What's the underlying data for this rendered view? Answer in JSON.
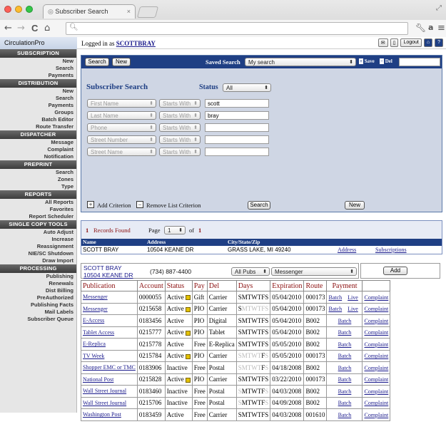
{
  "browser": {
    "tab_title": "Subscriber Search",
    "tab_close": "×",
    "url": "",
    "back": "←",
    "forward": "→",
    "reload": "C",
    "home": "⌂",
    "menu": "≡",
    "colors": {
      "red": "#fc5f57",
      "yellow": "#fdbb2d",
      "green": "#33c748"
    }
  },
  "header": {
    "brand": "CirculationPro",
    "logged_in_prefix": "Logged in as",
    "user": "SCOTTBRAY",
    "logout": "Logout"
  },
  "sidebar": [
    {
      "section": "SUBSCRIPTION",
      "items": [
        "New",
        "Search",
        "Payments"
      ]
    },
    {
      "section": "DISTRIBUTION",
      "items": [
        "New",
        "Search",
        "Payments",
        "Groups",
        "Batch Editor",
        "Route Transfer"
      ]
    },
    {
      "section": "DISPATCHER",
      "items": [
        "Message",
        "Complaint",
        "Notification"
      ]
    },
    {
      "section": "PREPRINT",
      "items": [
        "Search",
        "Zones",
        "Type"
      ]
    },
    {
      "section": "REPORTS",
      "items": [
        "All Reports",
        "Favorites",
        "Report Scheduler"
      ]
    },
    {
      "section": "SINGLE COPY TOOLS",
      "items": [
        "Auto Adjust",
        "Increase",
        "Reassignment",
        "NIE/SC Shutdown",
        "Draw Import"
      ]
    },
    {
      "section": "PROCESSING",
      "items": [
        "Publishing",
        "Renewals",
        "Dist Billing",
        "PreAuthorized",
        "Publishing Facts",
        "Mail Labels",
        "Subscriber Queue"
      ]
    }
  ],
  "search": {
    "search_btn": "Search",
    "new_btn": "New",
    "saved_search_label": "Saved Search",
    "saved_search_value": "My search",
    "save_label": "Save",
    "del_label": "Del",
    "title": "Subscriber Search",
    "status_label": "Status",
    "status_value": "All",
    "criteria": [
      {
        "field": "First Name",
        "op": "Starts With",
        "value": "scott"
      },
      {
        "field": "Last Name",
        "op": "Starts With",
        "value": "bray"
      },
      {
        "field": "Phone",
        "op": "Starts With",
        "value": ""
      },
      {
        "field": "Street Number",
        "op": "Starts With",
        "value": ""
      },
      {
        "field": "Street Name",
        "op": "Starts With",
        "value": ""
      }
    ],
    "add_criterion": "Add Criterion",
    "remove_criterion": "Remove List Criterion",
    "search_bottom": "Search",
    "new_bottom": "New"
  },
  "records": {
    "count": "1",
    "found_label": "Records Found",
    "page_label": "Page",
    "page_value": "1",
    "of_label": "of",
    "page_total": "1",
    "headers": {
      "name": "Name",
      "address": "Address",
      "csz": "City/State/Zip"
    },
    "row": {
      "name": "SCOTT BRAY",
      "address": "10504 KEANE DR",
      "csz": "GRASS LAKE, MI 49240",
      "address_link": "Address",
      "subs_link": "Subscriptions"
    }
  },
  "customer": {
    "name": "SCOTT BRAY",
    "address": "10504 KEANE DR",
    "phone": "(734) 887-4400",
    "pubs_filter": "All Pubs",
    "pub_select": "Messenger",
    "add_btn": "Add"
  },
  "subs_table": {
    "headers": [
      "Publication",
      "Account",
      "Status",
      "Pay",
      "Del",
      "Days",
      "Expiration",
      "Route",
      "Payment",
      ""
    ],
    "rows": [
      {
        "pub": "Messenger",
        "acct": "0000055",
        "status": "Active",
        "badge": true,
        "pay": "Gift",
        "del": "Carrier",
        "days_on": "SMTWTFS",
        "days_off": "",
        "exp": "05/04/2010",
        "route": "000173",
        "pay1": "Batch",
        "pay2": "Live",
        "complaint": "Complaint"
      },
      {
        "pub": "Messenger",
        "acct": "0215658",
        "status": "Active",
        "badge": true,
        "pay": "PIO",
        "del": "Carrier",
        "days_on": "S",
        "days_off": "MTWTFS",
        "exp": "05/04/2010",
        "route": "000173",
        "pay1": "Batch",
        "pay2": "Live",
        "complaint": "Complaint"
      },
      {
        "pub": "E-Access",
        "acct": "0183456",
        "status": "Active",
        "badge": false,
        "pay": "PIO",
        "del": "Digital",
        "days_on": "SMTWTFS",
        "days_off": "",
        "exp": "05/04/2010",
        "route": "B002",
        "pay1": "Batch",
        "pay2": "",
        "complaint": "Complaint"
      },
      {
        "pub": "Tablet Access",
        "acct": "0215777",
        "status": "Active",
        "badge": true,
        "pay": "PIO",
        "del": "Tablet",
        "days_on": "SMTWTFS",
        "days_off": "",
        "exp": "05/04/2010",
        "route": "B002",
        "pay1": "Batch",
        "pay2": "",
        "complaint": "Complaint"
      },
      {
        "pub": "E-Replica",
        "acct": "0215778",
        "status": "Active",
        "badge": false,
        "pay": "Free",
        "del": "E-Replica",
        "days_on": "SMTWTFS",
        "days_off": "",
        "exp": "05/05/2010",
        "route": "B002",
        "pay1": "Batch",
        "pay2": "",
        "complaint": "Complaint"
      },
      {
        "pub": "TV Week",
        "acct": "0215784",
        "status": "Active",
        "badge": true,
        "pay": "PIO",
        "del": "Carrier",
        "days_on": "F",
        "days_off": "SMTWT",
        "days_tail": "S",
        "exp": "05/05/2010",
        "route": "000173",
        "pay1": "Batch",
        "pay2": "",
        "complaint": "Complaint"
      },
      {
        "pub": "Shopper EMC or TMC",
        "acct": "0183906",
        "status": "Inactive",
        "badge": false,
        "pay": "Free",
        "del": "Postal",
        "days_on": "F",
        "days_off": "SMTWT",
        "days_tail": "S",
        "exp": "04/18/2008",
        "route": "B002",
        "pay1": "Batch",
        "pay2": "",
        "complaint": "Complaint"
      },
      {
        "pub": "National Post",
        "acct": "0215828",
        "status": "Active",
        "badge": true,
        "pay": "PIO",
        "del": "Carrier",
        "days_on": "SMTWTFS",
        "days_off": "",
        "exp": "03/22/2010",
        "route": "000173",
        "pay1": "Batch",
        "pay2": "",
        "complaint": "Complaint"
      },
      {
        "pub": "Wall Street Journal",
        "acct": "0183460",
        "status": "Inactive",
        "badge": false,
        "pay": "Free",
        "del": "Postal",
        "days_on": "MTWTF",
        "days_off": "S",
        "days_tail": "S",
        "exp": "04/03/2008",
        "route": "B002",
        "pay1": "Batch",
        "pay2": "",
        "complaint": "Complaint"
      },
      {
        "pub": "Wall Street Journal",
        "acct": "0215706",
        "status": "Inactive",
        "badge": false,
        "pay": "Free",
        "del": "Postal",
        "days_on": "MTWTF",
        "days_off": "S",
        "days_tail": "S",
        "exp": "04/09/2008",
        "route": "B002",
        "pay1": "Batch",
        "pay2": "",
        "complaint": "Complaint"
      },
      {
        "pub": "Washington Post",
        "acct": "0183459",
        "status": "Active",
        "badge": false,
        "pay": "Free",
        "del": "Carrier",
        "days_on": "SMTWTFS",
        "days_off": "",
        "exp": "04/03/2008",
        "route": "001610",
        "pay1": "Batch",
        "pay2": "",
        "complaint": "Complaint"
      }
    ]
  }
}
